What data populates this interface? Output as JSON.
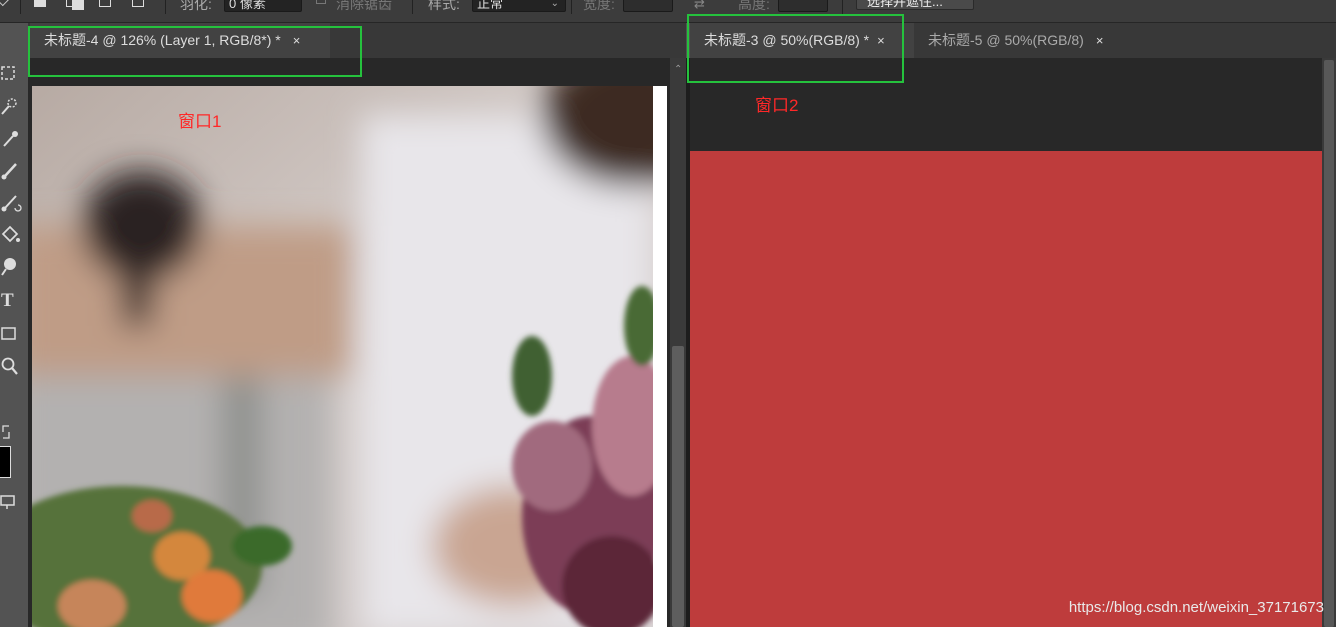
{
  "options_bar": {
    "feather_label": "羽化:",
    "feather_value": "0 像素",
    "antialias_label": "消除锯齿",
    "style_label": "样式:",
    "style_value": "正常",
    "width_label": "宽度:",
    "height_label": "高度:",
    "select_mask_button": "选择并遮住..."
  },
  "tabs_left": [
    {
      "label": "未标题-4 @ 126% (Layer 1, RGB/8*) *",
      "close": "×",
      "active": true
    }
  ],
  "tabs_right": [
    {
      "label": "未标题-3 @ 50%(RGB/8) *",
      "close": "×",
      "active": true
    },
    {
      "label": "未标题-5 @ 50%(RGB/8)",
      "close": "×",
      "active": false
    }
  ],
  "annotations": {
    "window1": "窗口1",
    "window2": "窗口2"
  },
  "colors": {
    "highlight": "#25c23d",
    "annotation": "#ff2828",
    "doc2_fill": "#be3c3c",
    "foreground_swatch": "#000000"
  },
  "tools": [
    {
      "icon": "rect-marquee-icon"
    },
    {
      "icon": "quick-select-icon"
    },
    {
      "icon": "eyedropper-icon"
    },
    {
      "icon": "brush-icon"
    },
    {
      "icon": "history-brush-icon"
    },
    {
      "icon": "paint-bucket-icon"
    },
    {
      "icon": "dodge-icon"
    },
    {
      "icon": "type-icon",
      "glyph": "T"
    },
    {
      "icon": "rectangle-icon"
    },
    {
      "icon": "zoom-icon"
    },
    {
      "icon": "swap-colors-icon"
    },
    {
      "icon": "foreground-color-icon"
    },
    {
      "icon": "screen-mode-icon"
    }
  ],
  "watermark": "https://blog.csdn.net/weixin_37171673"
}
